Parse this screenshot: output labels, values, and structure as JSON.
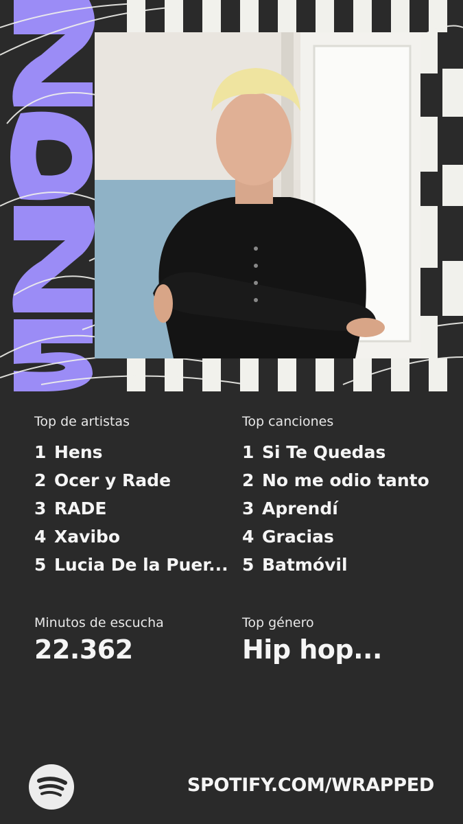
{
  "year_graphic": "2025",
  "artists": {
    "heading": "Top de artistas",
    "items": [
      {
        "rank": "1",
        "name": "Hens"
      },
      {
        "rank": "2",
        "name": "Ocer y Rade"
      },
      {
        "rank": "3",
        "name": "RADE"
      },
      {
        "rank": "4",
        "name": "Xavibo"
      },
      {
        "rank": "5",
        "name": "Lucia De la Puer..."
      }
    ]
  },
  "songs": {
    "heading": "Top canciones",
    "items": [
      {
        "rank": "1",
        "name": "Si Te Quedas"
      },
      {
        "rank": "2",
        "name": "No me odio tanto"
      },
      {
        "rank": "3",
        "name": "Aprendí"
      },
      {
        "rank": "4",
        "name": "Gracias"
      },
      {
        "rank": "5",
        "name": "Batmóvil"
      }
    ]
  },
  "minutes": {
    "label": "Minutos de escucha",
    "value": "22.362"
  },
  "genre": {
    "label": "Top género",
    "value": "Hip hop..."
  },
  "footer": {
    "url": "SPOTIFY.COM/WRAPPED",
    "logo_icon": "spotify-logo-icon"
  },
  "colors": {
    "background": "#2a2a2a",
    "accent": "#9b8cf6",
    "text": "#f5f5f5"
  }
}
